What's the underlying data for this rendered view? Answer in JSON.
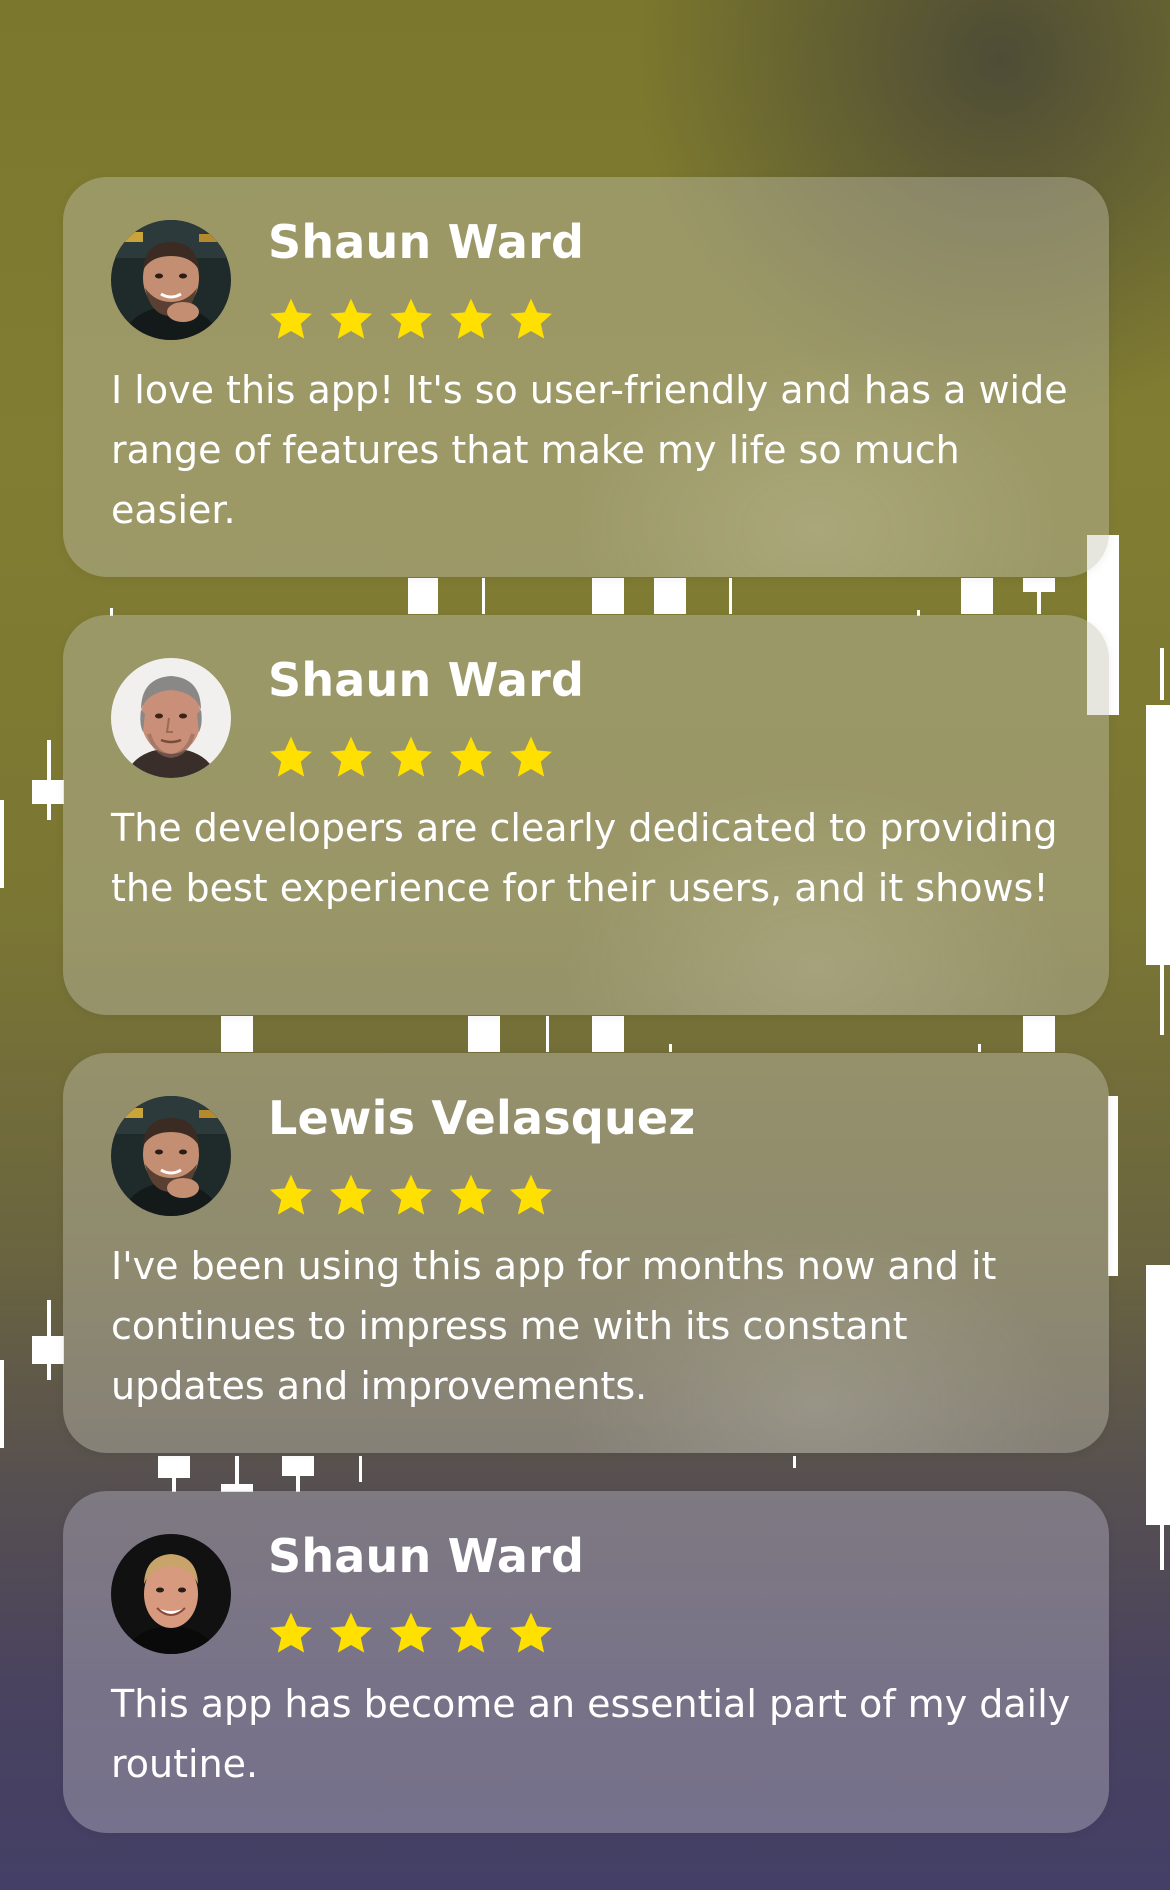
{
  "colors": {
    "star": "#ffe000",
    "text": "#ffffff",
    "background_top": "#7b772d",
    "background_bottom": "#433f66"
  },
  "reviews": [
    {
      "name": "Shaun Ward",
      "rating": 5,
      "avatar": "man-beard-smiling-photo",
      "text": "I love this app! It's so user-friendly and has a wide range of features that make my life so much easier."
    },
    {
      "name": "Shaun Ward",
      "rating": 5,
      "avatar": "man-gray-hair-photo",
      "text": "The developers are clearly dedicated to providing the best experience for their users, and it shows!"
    },
    {
      "name": "Lewis Velasquez",
      "rating": 5,
      "avatar": "man-beard-smiling-photo",
      "text": "I've been using this app for months now and it continues to impress me with its constant updates and improvements."
    },
    {
      "name": "Shaun Ward",
      "rating": 5,
      "avatar": "man-blond-smiling-photo",
      "text": "This app has become an essential part of my daily routine."
    }
  ]
}
